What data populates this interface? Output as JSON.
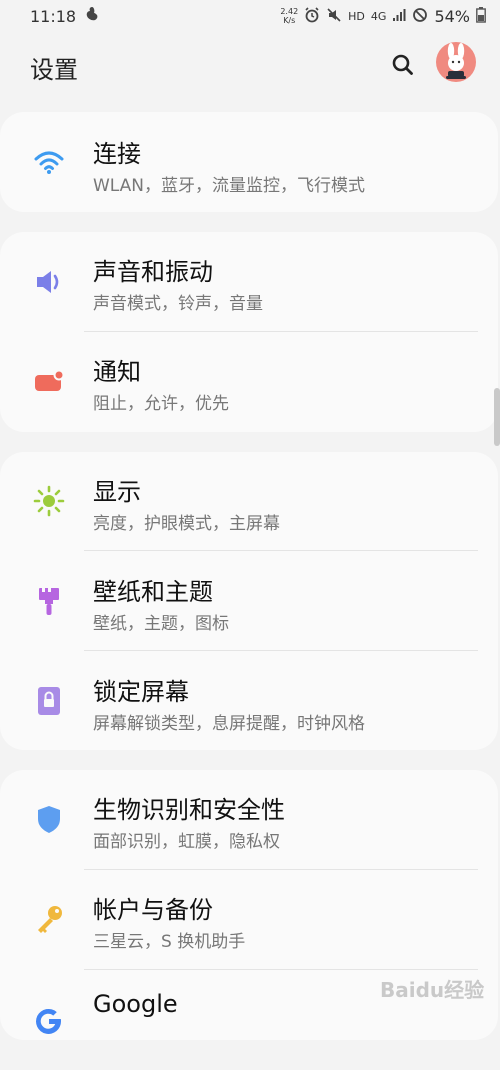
{
  "status_bar": {
    "time": "11:18",
    "net_speed_value": "2.42",
    "net_speed_unit": "K/s",
    "network": "HD",
    "signal": "4G",
    "battery": "54%"
  },
  "header": {
    "title": "设置"
  },
  "groups": [
    {
      "items": [
        {
          "title": "连接",
          "subtitle": "WLAN，蓝牙，流量监控，飞行模式",
          "icon": "wifi-icon",
          "color": "#3d9bf0"
        }
      ]
    },
    {
      "items": [
        {
          "title": "声音和振动",
          "subtitle": "声音模式，铃声，音量",
          "icon": "speaker-icon",
          "color": "#7b7fe8"
        },
        {
          "title": "通知",
          "subtitle": "阻止，允许，优先",
          "icon": "notification-icon",
          "color": "#ef6b5c"
        }
      ]
    },
    {
      "items": [
        {
          "title": "显示",
          "subtitle": "亮度，护眼模式，主屏幕",
          "icon": "brightness-icon",
          "color": "#9ccc3c"
        },
        {
          "title": "壁纸和主题",
          "subtitle": "壁纸，主题，图标",
          "icon": "paintbrush-icon",
          "color": "#b665e0"
        },
        {
          "title": "锁定屏幕",
          "subtitle": "屏幕解锁类型，息屏提醒，时钟风格",
          "icon": "lock-icon",
          "color": "#a88be6"
        }
      ]
    },
    {
      "items": [
        {
          "title": "生物识别和安全性",
          "subtitle": "面部识别，虹膜，隐私权",
          "icon": "shield-icon",
          "color": "#5d9ef0"
        },
        {
          "title": "帐户与备份",
          "subtitle": "三星云，S 换机助手",
          "icon": "key-icon",
          "color": "#f0b83d"
        },
        {
          "title": "Google",
          "subtitle": "",
          "icon": "google-icon",
          "color": "#4285f4"
        }
      ]
    }
  ],
  "watermark": "Baidu经验"
}
